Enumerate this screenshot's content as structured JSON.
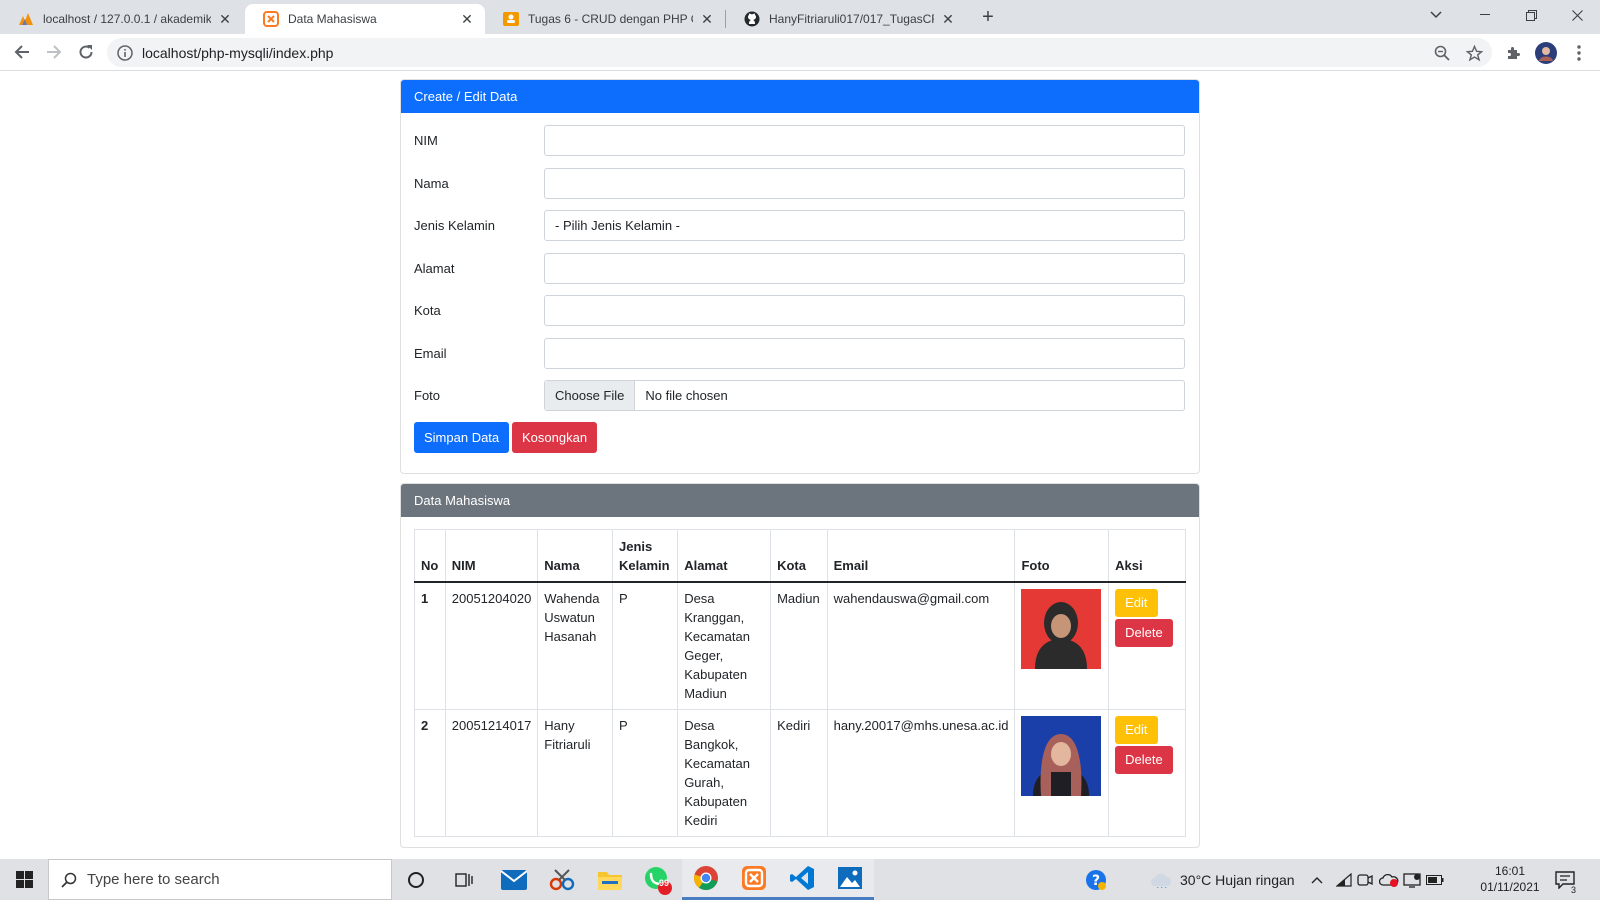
{
  "browser": {
    "tabs": [
      {
        "title": "localhost / 127.0.0.1 / akademik /",
        "icon": "phpmyadmin-icon"
      },
      {
        "title": "Data Mahasiswa",
        "icon": "xampp-icon"
      },
      {
        "title": "Tugas 6 - CRUD dengan PHP OO",
        "icon": "classroom-icon"
      },
      {
        "title": "HanyFitriaruli017/017_TugasCRUD",
        "icon": "github-icon"
      }
    ],
    "url": "localhost/php-mysqli/index.php"
  },
  "form_card": {
    "header": "Create / Edit Data",
    "fields": {
      "nim": {
        "label": "NIM",
        "value": ""
      },
      "nama": {
        "label": "Nama",
        "value": ""
      },
      "jk": {
        "label": "Jenis Kelamin",
        "value": "- Pilih Jenis Kelamin -"
      },
      "alamat": {
        "label": "Alamat",
        "value": ""
      },
      "kota": {
        "label": "Kota",
        "value": ""
      },
      "email": {
        "label": "Email",
        "value": ""
      },
      "foto": {
        "label": "Foto",
        "button": "Choose File",
        "status": "No file chosen"
      }
    },
    "save_label": "Simpan Data",
    "clear_label": "Kosongkan"
  },
  "table_card": {
    "header": "Data Mahasiswa",
    "columns": [
      "No",
      "NIM",
      "Nama",
      "Jenis Kelamin",
      "Alamat",
      "Kota",
      "Email",
      "Foto",
      "Aksi"
    ],
    "rows": [
      {
        "no": "1",
        "nim": "20051204020",
        "nama": "Wahenda Uswatun Hasanah",
        "jk": "P",
        "alamat": "Desa Kranggan, Kecamatan Geger, Kabupaten Madiun",
        "kota": "Madiun",
        "email": "wahendauswa@gmail.com",
        "photo_bg": "#e53935",
        "photo_veil": "#2b2b2b",
        "edit": "Edit",
        "delete": "Delete"
      },
      {
        "no": "2",
        "nim": "20051214017",
        "nama": "Hany Fitriaruli",
        "jk": "P",
        "alamat": "Desa Bangkok, Kecamatan Gurah, Kabupaten Kediri",
        "kota": "Kediri",
        "email": "hany.20017@mhs.unesa.ac.id",
        "photo_bg": "#1a3fa8",
        "photo_veil": "#a8605a",
        "edit": "Edit",
        "delete": "Delete"
      }
    ]
  },
  "taskbar": {
    "search_placeholder": "Type here to search",
    "weather": "30°C  Hujan ringan",
    "time": "16:01",
    "date": "01/11/2021",
    "whatsapp_badge": "99",
    "notification_count": "3"
  }
}
